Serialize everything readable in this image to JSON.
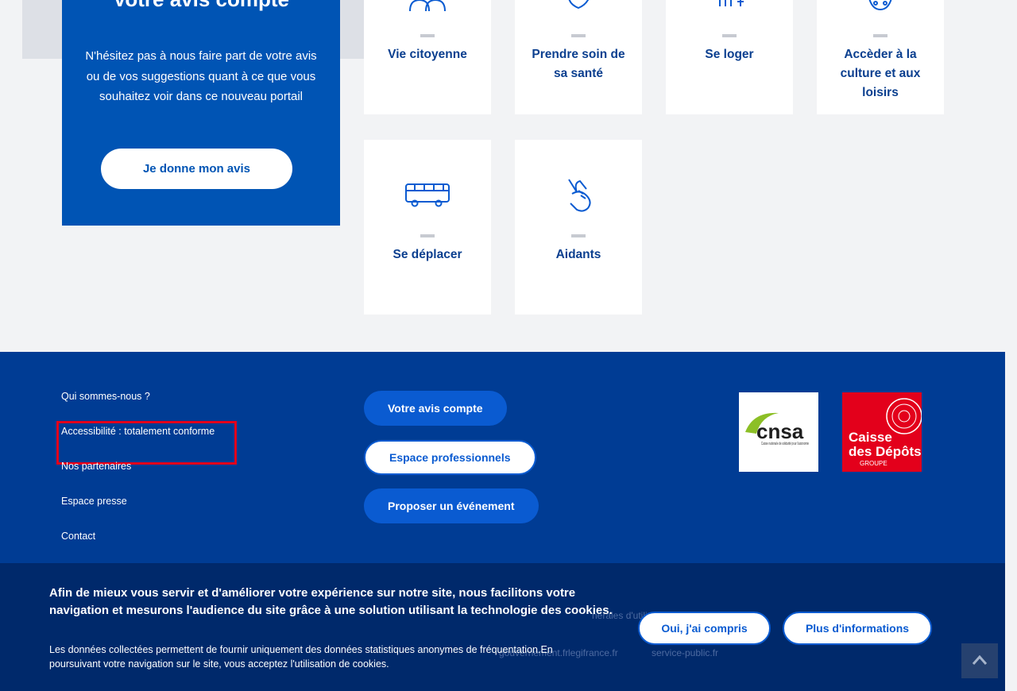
{
  "colors": {
    "primary": "#0054b4",
    "footer": "#003c94",
    "cookie": "#00296b",
    "highlight": "#e3001b"
  },
  "avis": {
    "title": "Votre avis compte",
    "text": "N'hésitez pas à nous faire part de votre avis ou de vos suggestions quant à ce que vous souhaitez voir dans ce nouveau portail",
    "button": "Je donne mon avis"
  },
  "tiles": [
    {
      "label": "Vie citoyenne",
      "icon": "people-icon"
    },
    {
      "label": "Prendre soin de sa santé",
      "icon": "health-icon"
    },
    {
      "label": "Se loger",
      "icon": "house-icon"
    },
    {
      "label": "Accèder à la culture et aux loisirs",
      "icon": "culture-icon"
    },
    {
      "label": "Se déplacer",
      "icon": "bus-icon"
    },
    {
      "label": "Aidants",
      "icon": "helping-hand-icon"
    }
  ],
  "footer": {
    "links": [
      "Qui sommes-nous ?",
      "Accessibilité : totalement conforme",
      "Nos partenaires",
      "Espace presse",
      "Contact"
    ],
    "buttons": [
      "Votre avis compte",
      "Espace professionnels",
      "Proposer un événement"
    ],
    "logos": {
      "cnsa_name": "cnsa",
      "cnsa_caption": "Caisse nationale de solidarité pour l'autonomie",
      "cdc_line1": "Caisse",
      "cdc_line2": "des Dépôts",
      "cdc_line3": "GROUPE"
    },
    "bottom_links": [
      "gouvernement.fr",
      "legifrance.fr",
      "service-public.fr"
    ],
    "partial_text": "nérales d'utilisation"
  },
  "cookie": {
    "title": "Afin de mieux vous servir et d'améliorer votre expérience sur notre site, nous facilitons votre navigation et mesurons l'audience du site grâce à une solution utilisant la technologie des cookies.",
    "text": "Les données collectées permettent de fournir uniquement des données statistiques anonymes de fréquentation.En poursuivant votre navigation sur le site, vous acceptez l'utilisation de cookies.",
    "accept": "Oui, j'ai compris",
    "more": "Plus d'informations"
  }
}
